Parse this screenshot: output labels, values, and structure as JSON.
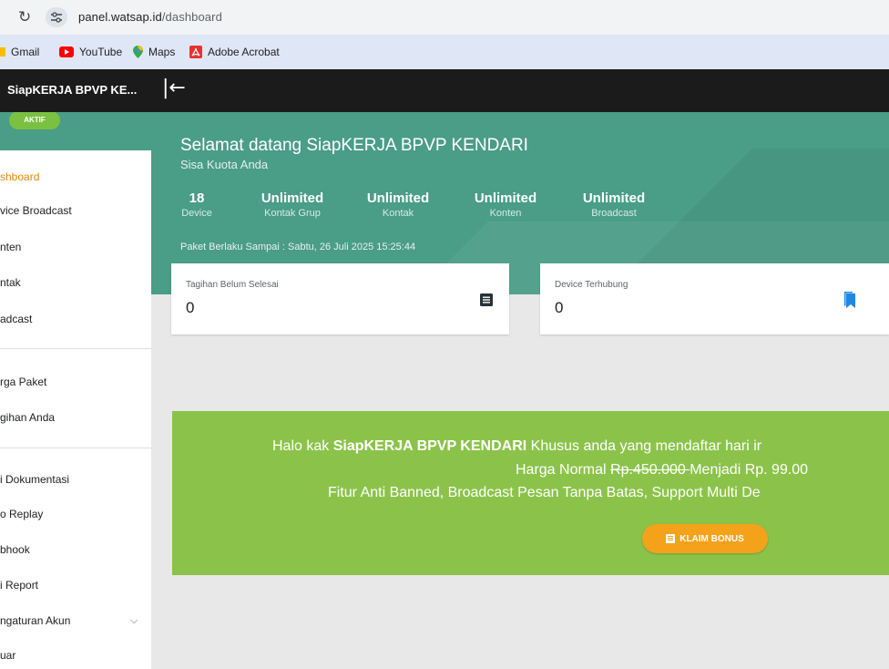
{
  "browser": {
    "reload_icon": "reload-icon",
    "url_host": "panel.watsap.id",
    "url_path": "/dashboard",
    "bookmarks": [
      {
        "label": "Gmail",
        "icon": "gmail-icon"
      },
      {
        "label": "YouTube",
        "icon": "youtube-icon"
      },
      {
        "label": "Maps",
        "icon": "maps-icon"
      },
      {
        "label": "Adobe Acrobat",
        "icon": "acrobat-icon"
      }
    ]
  },
  "sidebar": {
    "title": "SiapKERJA BPVP KE...",
    "status_badge": "AKTIF",
    "items": [
      {
        "label": "shboard",
        "active": true
      },
      {
        "label": "vice Broadcast"
      },
      {
        "label": "nten"
      },
      {
        "label": "ntak"
      },
      {
        "label": "adcast"
      },
      {
        "label": "rga Paket"
      },
      {
        "label": "gihan Anda"
      },
      {
        "label": "i Dokumentasi"
      },
      {
        "label": "o Replay"
      },
      {
        "label": "bhook"
      },
      {
        "label": "i Report"
      },
      {
        "label": "ngaturan Akun"
      },
      {
        "label": "uar"
      }
    ]
  },
  "topbar": {
    "collapse_icon": "collapse-sidebar-icon"
  },
  "hero": {
    "welcome": "Selamat datang SiapKERJA BPVP KENDARI",
    "quota_label": "Sisa Kuota Anda",
    "stats": [
      {
        "value": "18",
        "label": "Device"
      },
      {
        "value": "Unlimited",
        "label": "Kontak Grup"
      },
      {
        "value": "Unlimited",
        "label": "Kontak"
      },
      {
        "value": "Unlimited",
        "label": "Konten"
      },
      {
        "value": "Unlimited",
        "label": "Broadcast"
      }
    ],
    "expiry": "Paket Berlaku Sampai : Sabtu, 26 Juli 2025 15:25:44"
  },
  "cards": [
    {
      "title": "Tagihan Belum Selesai",
      "value": "0",
      "icon": "document-list-icon"
    },
    {
      "title": "Device Terhubung",
      "value": "0",
      "icon": "bookmark-icon"
    }
  ],
  "promo": {
    "line1_pre": "Halo kak ",
    "line1_bold": "SiapKERJA BPVP KENDARI",
    "line1_post": " Khusus anda yang mendaftar hari ir",
    "line2_pre": "Harga Normal ",
    "line2_strike": "Rp.450.000 ",
    "line2_post": "Menjadi Rp. 99.00",
    "line3": "Fitur Anti Banned, Broadcast Pesan Tanpa Batas, Support Multi De",
    "button_label": "KLAIM BONUS"
  },
  "colors": {
    "hero_bg": "#4a9d87",
    "topbar_bg": "#1b1b1b",
    "promo_bg": "#8bc34a",
    "accent_orange": "#f4a21a",
    "badge_green": "#7ac142",
    "active_nav": "#e08a00",
    "bookmark_blue": "#1e88e5"
  }
}
